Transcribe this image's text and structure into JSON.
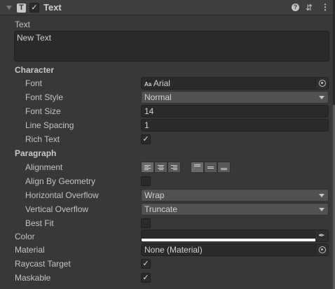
{
  "header": {
    "title": "Text",
    "enabled": true,
    "icons": [
      "foldout-triangle-icon",
      "text-component-icon",
      "help-icon",
      "preset-sliders-icon",
      "kebab-menu-icon"
    ]
  },
  "text": {
    "label": "Text",
    "value": "New Text"
  },
  "character": {
    "label": "Character",
    "font": {
      "label": "Font",
      "value": "Arial",
      "prefix": "Aa"
    },
    "font_style": {
      "label": "Font Style",
      "value": "Normal"
    },
    "font_size": {
      "label": "Font Size",
      "value": "14"
    },
    "line_spacing": {
      "label": "Line Spacing",
      "value": "1"
    },
    "rich_text": {
      "label": "Rich Text",
      "checked": true
    }
  },
  "paragraph": {
    "label": "Paragraph",
    "alignment": {
      "label": "Alignment",
      "horizontal": "left",
      "vertical": "top"
    },
    "align_by_geometry": {
      "label": "Align By Geometry",
      "checked": false
    },
    "horizontal_overflow": {
      "label": "Horizontal Overflow",
      "value": "Wrap"
    },
    "vertical_overflow": {
      "label": "Vertical Overflow",
      "value": "Truncate"
    },
    "best_fit": {
      "label": "Best Fit",
      "checked": false
    }
  },
  "color": {
    "label": "Color",
    "value": "#ffffff"
  },
  "material": {
    "label": "Material",
    "value": "None (Material)"
  },
  "raycast_target": {
    "label": "Raycast Target",
    "checked": true
  },
  "maskable": {
    "label": "Maskable",
    "checked": true
  }
}
